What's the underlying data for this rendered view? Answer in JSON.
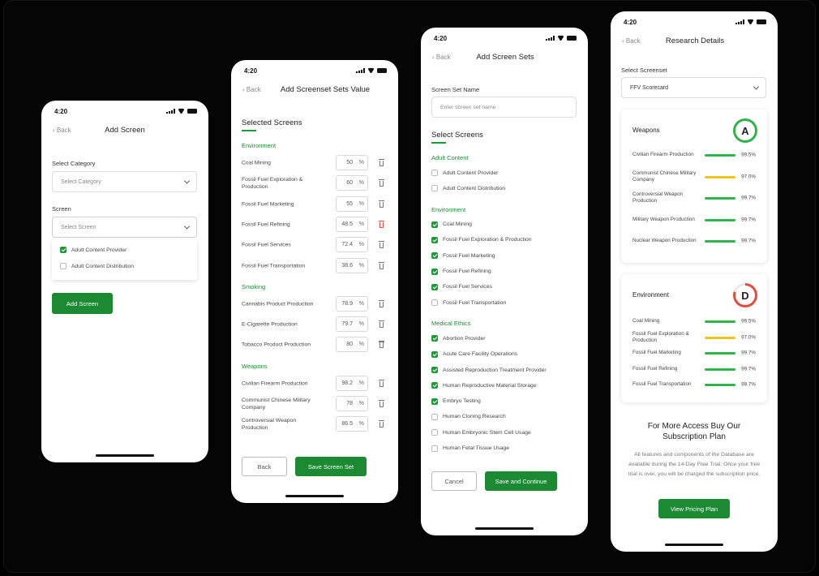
{
  "colors": {
    "accent": "#1b8a33",
    "bar_good": "#2fb34a",
    "bar_warn": "#f0c419",
    "grade_a": "#2fb34a",
    "grade_d": "#e34b3a",
    "delete_red": "#e34b3a"
  },
  "status_time": "4:20",
  "back_label": "Back",
  "screen1": {
    "title": "Add Screen",
    "category_label": "Select Category",
    "category_placeholder": "Select Category",
    "screen_label": "Screen",
    "screen_placeholder": "Select Screen",
    "options": [
      {
        "label": "Adult Content Provider",
        "checked": true
      },
      {
        "label": "Adult Content Distribution",
        "checked": false
      }
    ],
    "button": "Add Screen"
  },
  "screen2": {
    "title": "Add Screenset Sets Value",
    "heading": "Selected Screens",
    "groups": [
      {
        "name": "Environment",
        "rows": [
          {
            "label": "Coal Mining",
            "value": "50"
          },
          {
            "label": "Fossil Fuel Exploration & Production",
            "value": "60"
          },
          {
            "label": "Fossil Fuel Marketing",
            "value": "55"
          },
          {
            "label": "Fossil Fuel Refining",
            "value": "48.5"
          },
          {
            "label": "Fossil Fuel Services",
            "value": "72.4"
          },
          {
            "label": "Fossil Fuel Transportation",
            "value": "38.6"
          }
        ]
      },
      {
        "name": "Smoking",
        "rows": [
          {
            "label": "Cannabis Product Production",
            "value": "78.9"
          },
          {
            "label": "E-Cigarette Production",
            "value": "79.7"
          },
          {
            "label": "Tobacco Product Production",
            "value": "80"
          }
        ]
      },
      {
        "name": "Weapons",
        "rows": [
          {
            "label": "Civilian Firearm Production",
            "value": "98.2"
          },
          {
            "label": "Communist Chinese Military Company",
            "value": "78"
          },
          {
            "label": "Controversial Weapon Production",
            "value": "86.5"
          }
        ]
      }
    ],
    "pct": "%",
    "back_button": "Back",
    "save_button": "Save Screen Set"
  },
  "screen3": {
    "title": "Add Screen Sets",
    "name_label": "Screen Set Name",
    "name_placeholder": "Enter screen set name",
    "heading": "Select Screens",
    "groups": [
      {
        "name": "Adult Content",
        "items": [
          {
            "label": "Adult Content Provider",
            "checked": false
          },
          {
            "label": "Adult Content Distribution",
            "checked": false
          }
        ]
      },
      {
        "name": "Environment",
        "items": [
          {
            "label": "Coal Mining",
            "checked": true
          },
          {
            "label": "Fossil Fuel Exploration & Production",
            "checked": true
          },
          {
            "label": "Fossil Fuel Marketing",
            "checked": true
          },
          {
            "label": "Fossil Fuel Refining",
            "checked": true
          },
          {
            "label": "Fossil Fuel Services",
            "checked": true
          },
          {
            "label": "Fossil Fuel Transportation",
            "checked": false
          }
        ]
      },
      {
        "name": "Medical Ethics",
        "items": [
          {
            "label": "Abortion Provider",
            "checked": true
          },
          {
            "label": "Acute Care Facility Operations",
            "checked": true
          },
          {
            "label": "Assisted Reproduction Treatment Provider",
            "checked": true
          },
          {
            "label": "Human Reproductive Material Storage",
            "checked": true
          },
          {
            "label": "Embryo Testing",
            "checked": true
          },
          {
            "label": "Human Cloning Research",
            "checked": false
          },
          {
            "label": "Human Embryonic Stem Cell Usage",
            "checked": false
          },
          {
            "label": "Human Fetal Tissue Usage",
            "checked": false
          }
        ]
      }
    ],
    "cancel_button": "Cancel",
    "save_button": "Save and Continue"
  },
  "screen4": {
    "title": "Research Details",
    "select_label": "Select Screenset",
    "select_value": "FFV Scorecard",
    "cards": [
      {
        "title": "Weapons",
        "grade": "A",
        "grade_fill": 1.0,
        "rows": [
          {
            "label": "Civilian Firearm Production",
            "value": "99.5%",
            "status": "good"
          },
          {
            "label": "Communist Chinese Military Company",
            "value": "97.0%",
            "status": "warn"
          },
          {
            "label": "Controversial Weapon Production",
            "value": "99.7%",
            "status": "good"
          },
          {
            "label": "Military Weapon Production",
            "value": "99.7%",
            "status": "good"
          },
          {
            "label": "Nuclear Weapon Production",
            "value": "99.7%",
            "status": "good"
          }
        ]
      },
      {
        "title": "Environment",
        "grade": "D",
        "grade_fill": 0.8,
        "rows": [
          {
            "label": "Coal Mining",
            "value": "99.5%",
            "status": "good"
          },
          {
            "label": "Fossil Fuel Exploration & Production",
            "value": "97.0%",
            "status": "warn"
          },
          {
            "label": "Fossil Fuel Marketing",
            "value": "99.7%",
            "status": "good"
          },
          {
            "label": "Fossil Fuel Refining",
            "value": "99.7%",
            "status": "good"
          },
          {
            "label": "Fossil Fuel Transportation",
            "value": "99.7%",
            "status": "good"
          }
        ]
      }
    ],
    "promo_title": "For More Access Buy Our Subscription Plan",
    "promo_text": "All features and components of the Database are available during the 14-Day Free Trial. Once your free trial is over, you will be charged the subscription price.",
    "promo_button": "View Pricing Plan"
  }
}
